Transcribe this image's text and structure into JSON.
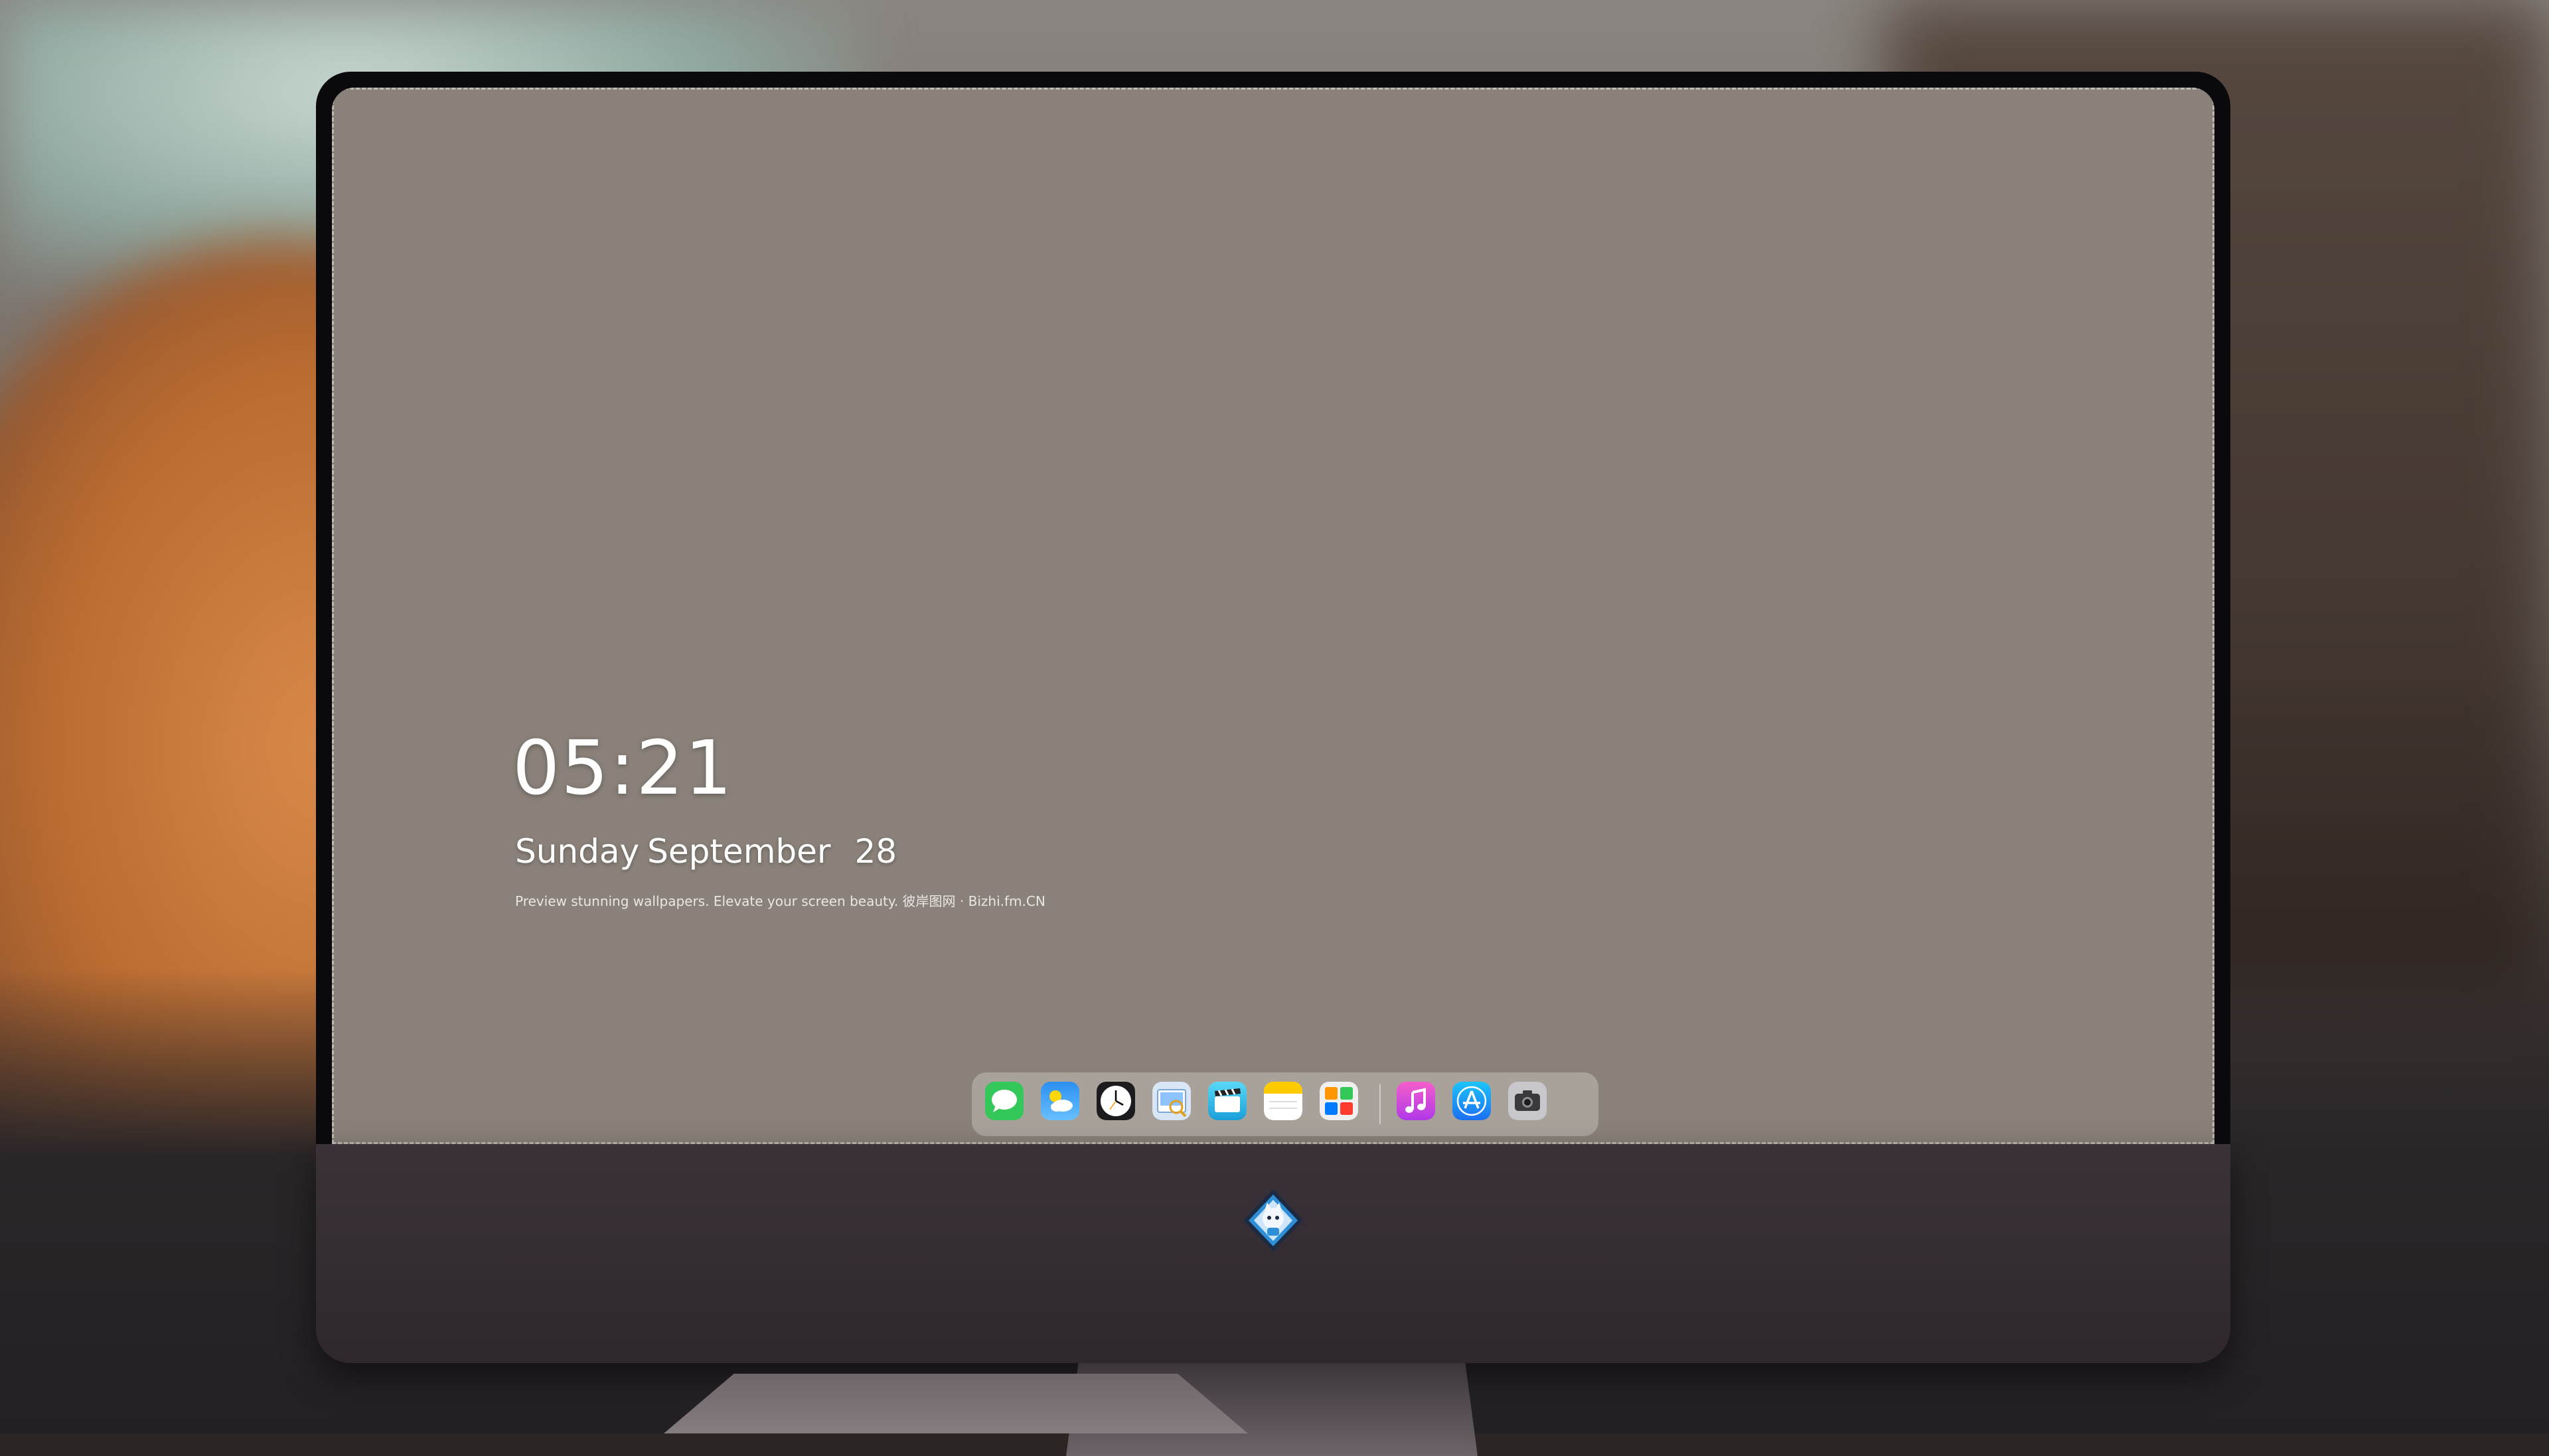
{
  "lockscreen": {
    "time": "05:21",
    "weekday": "Sunday",
    "month": "September",
    "day": "28",
    "tagline": "Preview stunning wallpapers. Elevate your screen beauty. 彼岸图网 · Bizhi.fm.CN"
  },
  "dock": {
    "items": [
      {
        "name": "messages-icon"
      },
      {
        "name": "weather-icon"
      },
      {
        "name": "clock-icon"
      },
      {
        "name": "preview-icon"
      },
      {
        "name": "clips-icon"
      },
      {
        "name": "notes-icon"
      },
      {
        "name": "photos-gallery-icon"
      },
      {
        "name": "music-icon"
      },
      {
        "name": "app-store-icon"
      },
      {
        "name": "camera-icon"
      }
    ]
  },
  "colors": {
    "chin": "#2e282e",
    "bezel": "#0a0a0c",
    "dock_bg": "rgba(220,215,210,0.38)",
    "text": "#ffffff"
  }
}
